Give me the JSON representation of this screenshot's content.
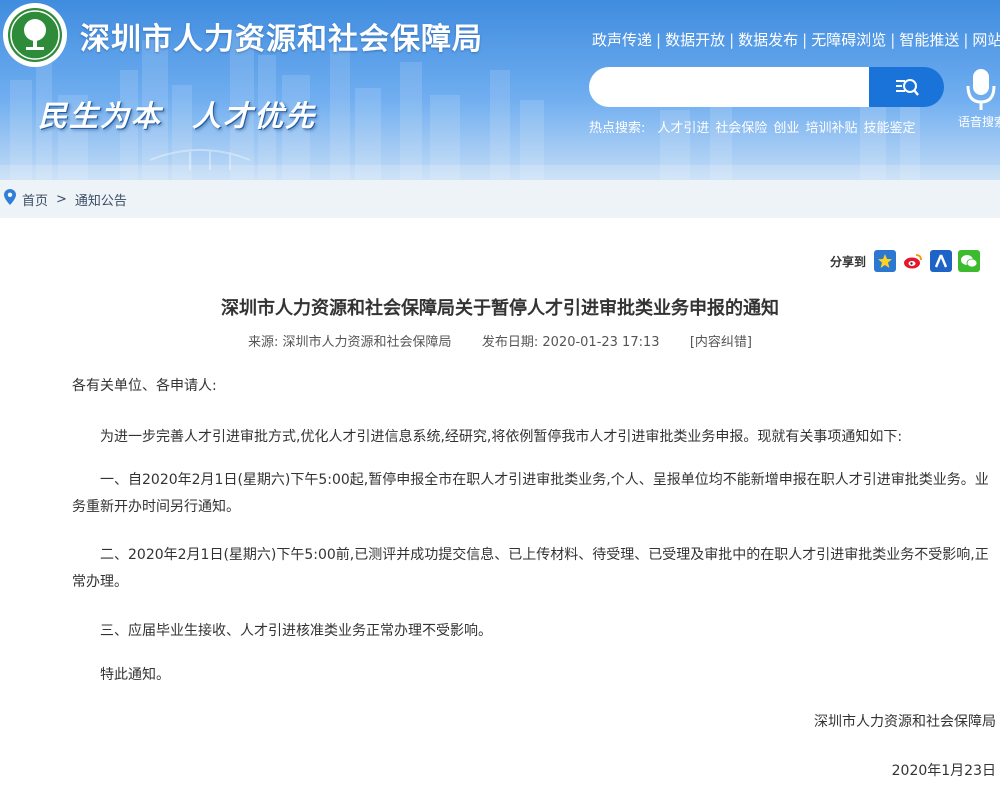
{
  "header": {
    "site_title": "深圳市人力资源和社会保障局",
    "slogan": "民生为本 人才优先",
    "nav": [
      "政声传递",
      "数据开放",
      "数据发布",
      "无障碍浏览",
      "智能推送",
      "网站"
    ],
    "search": {
      "placeholder": ""
    },
    "voice_label": "语音搜索",
    "hot_search": {
      "label": "热点搜索:",
      "items": [
        "人才引进",
        "社会保险",
        "创业",
        "培训补贴",
        "技能鉴定"
      ]
    }
  },
  "breadcrumb": {
    "home": "首页",
    "separator": ">",
    "current": "通知公告"
  },
  "share": {
    "label": "分享到"
  },
  "article": {
    "title": "深圳市人力资源和社会保障局关于暂停人才引进审批类业务申报的通知",
    "source_label": "来源:",
    "source": "深圳市人力资源和社会保障局",
    "date_label": "发布日期:",
    "date": "2020-01-23 17:13",
    "correction": "[内容纠错]",
    "greeting": "各有关单位、各申请人:",
    "paragraphs": [
      "为进一步完善人才引进审批方式,优化人才引进信息系统,经研究,将依例暂停我市人才引进审批类业务申报。现就有关事项通知如下:",
      "一、自2020年2月1日(星期六)下午5:00起,暂停申报全市在职人才引进审批类业务,个人、呈报单位均不能新增申报在职人才引进审批类业务。业务重新开办时间另行通知。",
      "二、2020年2月1日(星期六)下午5:00前,已测评并成功提交信息、已上传材料、待受理、已受理及审批中的在职人才引进审批类业务不受影响,正常办理。",
      "三、应届毕业生接收、人才引进核准类业务正常办理不受影响。",
      "特此通知。"
    ],
    "signature_org": "深圳市人力资源和社会保障局",
    "signature_date": "2020年1月23日"
  },
  "colors": {
    "banner_top": "#3f8cdf",
    "banner_bottom": "#c3dcf6",
    "search_button": "#1a73d8",
    "breadcrumb_bg": "#eef3f8",
    "logo_green": "#2e8b3a"
  }
}
